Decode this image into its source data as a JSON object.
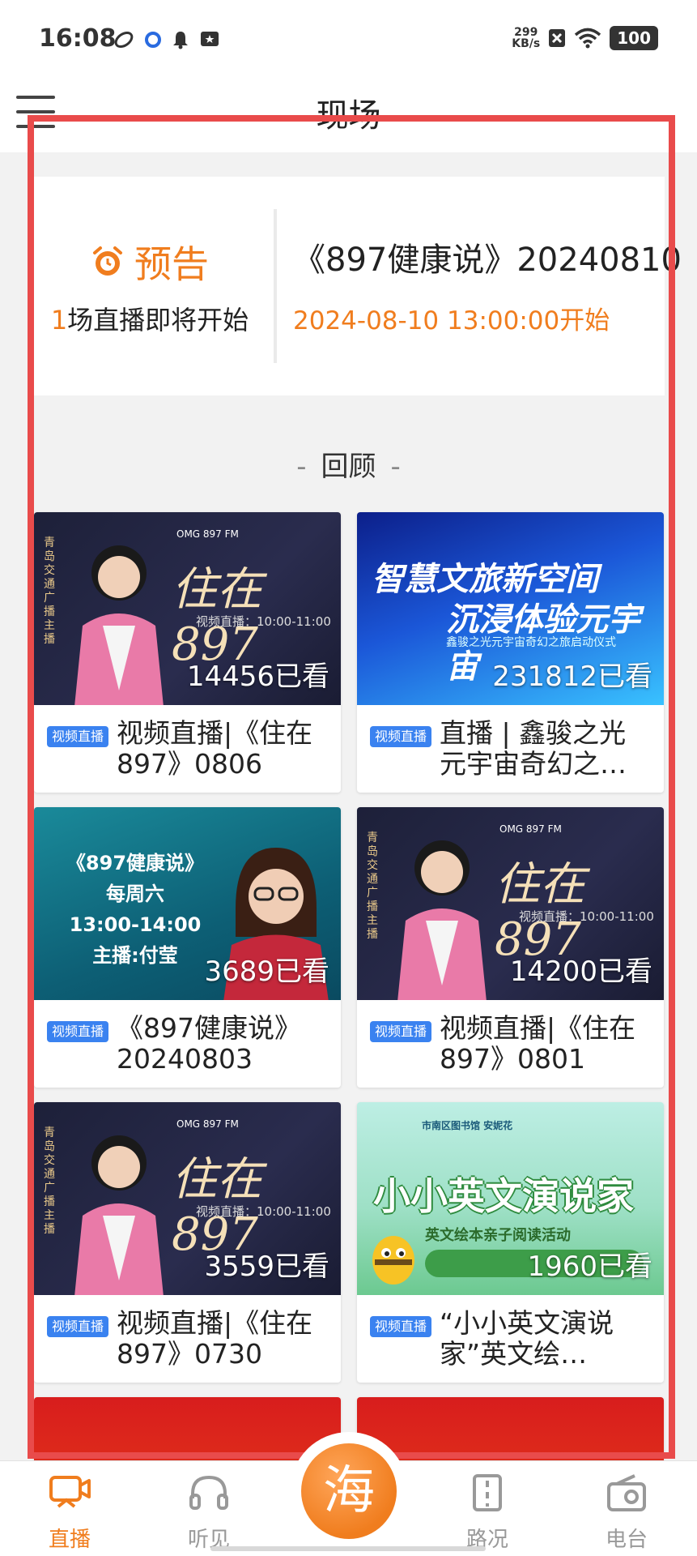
{
  "status_bar": {
    "time": "16:08",
    "netspeed_value": "299",
    "netspeed_unit": "KB/s",
    "battery": "100"
  },
  "header": {
    "title": "现场"
  },
  "preview": {
    "label": "预告",
    "count_num": "1",
    "count_text": "场直播即将开始",
    "title": "《897健康说》20240810",
    "time": "2024-08-10 13:00:00开始"
  },
  "review": {
    "title": "回顾",
    "dash": "-"
  },
  "cards": [
    {
      "tag": "视频直播",
      "title": "视频直播|《住在897》0806",
      "views": "14456已看",
      "headline": "住在897",
      "sub": "视频直播：10:00-11:00",
      "vtext": "青岛交通广播主播",
      "logos": "OMG  897  FM"
    },
    {
      "tag": "视频直播",
      "title": "直播 | 鑫骏之光元宇宙奇幻之…",
      "views": "231812已看",
      "l1": "智慧文旅新空间",
      "l2": "沉浸体验元宇宙",
      "l3": "鑫骏之光元宇宙奇幻之旅启动仪式"
    },
    {
      "tag": "视频直播",
      "title": "《897健康说》20240803",
      "views": "3689已看",
      "txt1": "《897健康说》",
      "txt2": "每周六",
      "txt3": "13:00-14:00",
      "txt4": "主播:付莹"
    },
    {
      "tag": "视频直播",
      "title": "视频直播|《住在897》0801",
      "views": "14200已看",
      "headline": "住在897",
      "sub": "视频直播：10:00-11:00",
      "vtext": "青岛交通广播主播",
      "logos": "OMG  897  FM"
    },
    {
      "tag": "视频直播",
      "title": "视频直播|《住在897》0730",
      "views": "3559已看",
      "headline": "住在897",
      "sub": "视频直播：10:00-11:00",
      "vtext": "青岛交通广播主播",
      "logos": "OMG  897  FM"
    },
    {
      "tag": "视频直播",
      "title": "“小小英文演说家”英文绘…",
      "views": "1960已看",
      "big": "小小英文演说家",
      "small": "英文绘本亲子阅读活动",
      "logo": "市南区图书馆  安妮花"
    }
  ],
  "tabs": [
    {
      "label": "直播",
      "icon": "live-tv-icon"
    },
    {
      "label": "听见",
      "icon": "headphones-icon"
    },
    {
      "label": "海",
      "icon": "sea-logo-icon"
    },
    {
      "label": "路况",
      "icon": "traffic-icon"
    },
    {
      "label": "电台",
      "icon": "radio-icon"
    }
  ],
  "colors": {
    "accent": "#f07d1e",
    "tag_blue": "#3a82f0",
    "highlight_red": "#e94b4b"
  }
}
